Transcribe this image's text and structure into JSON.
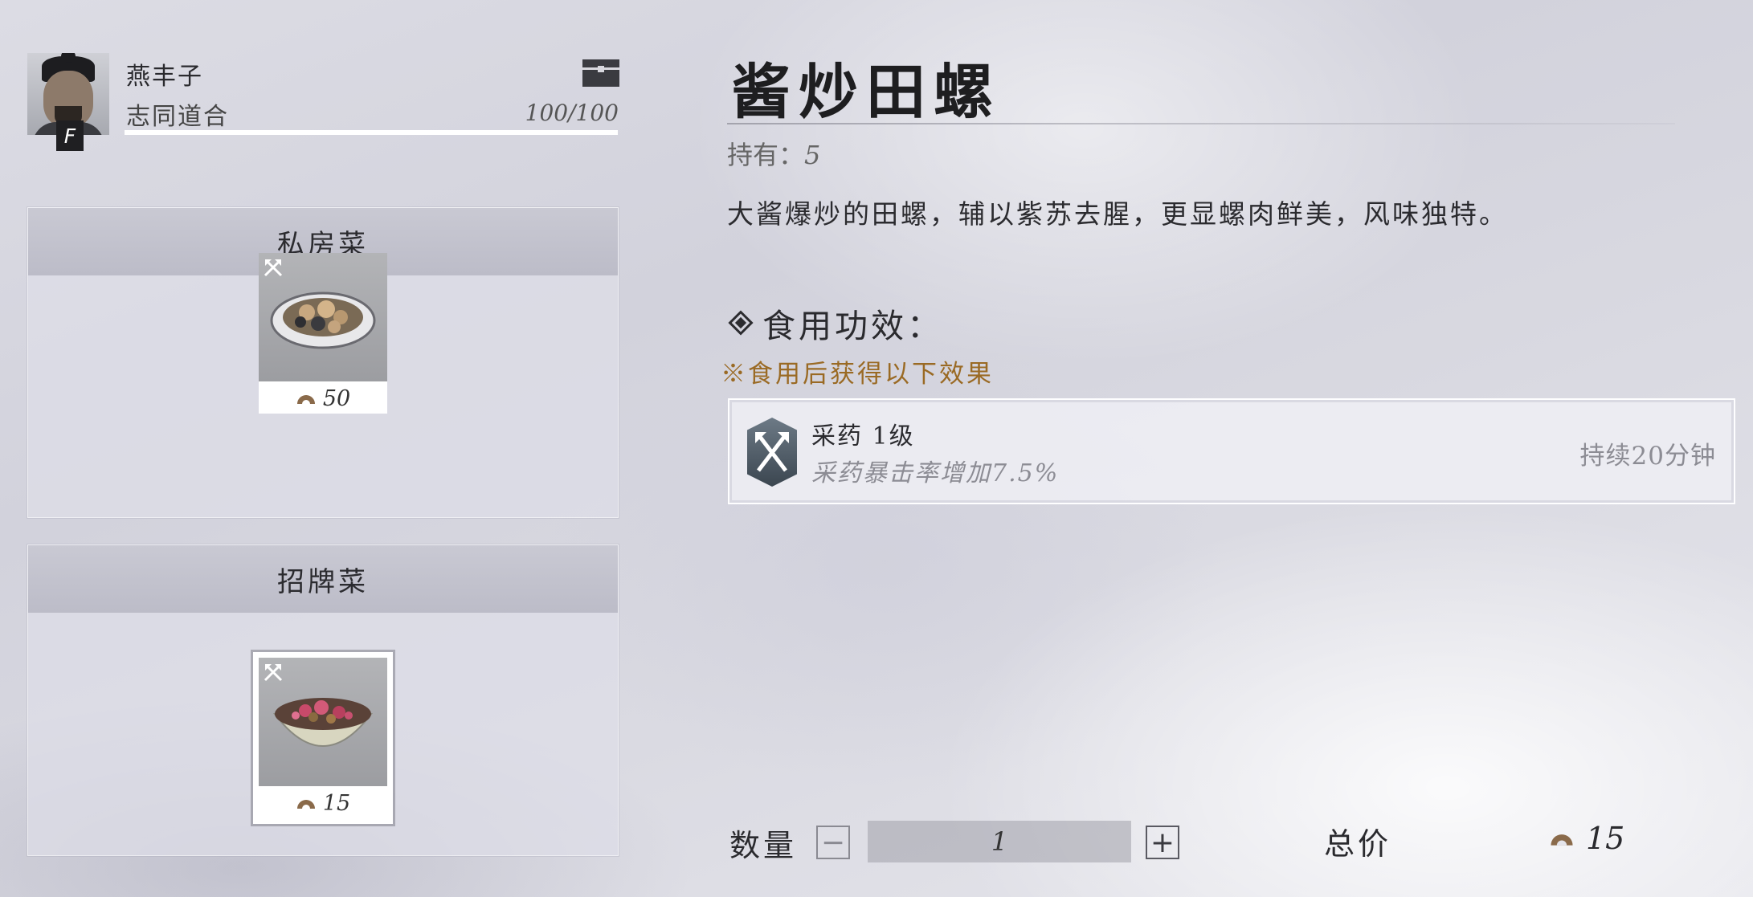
{
  "player": {
    "name": "燕丰子",
    "relation": "志同道合",
    "affinity": "100/100",
    "affinity_fraction": 1.0,
    "rank_badge": "F",
    "icons": {
      "chest": "chest-icon"
    }
  },
  "menus": [
    {
      "title": "私房菜",
      "dish": {
        "price": "50",
        "tool_icon": "crossed-axes-icon",
        "currency_icon": "coin-icon"
      }
    },
    {
      "title": "招牌菜",
      "dish": {
        "price": "15",
        "tool_icon": "crossed-axes-icon",
        "currency_icon": "coin-icon",
        "selected": true
      }
    }
  ],
  "detail": {
    "title": "酱炒田螺",
    "hold_label": "持有：",
    "hold_value": "5",
    "description": "大酱爆炒的田螺，辅以紫苏去腥，更显螺肉鲜美，风味独特。",
    "effect_heading": "食用功效：",
    "effect_note": "※食用后获得以下效果",
    "effect": {
      "name": "采药 1级",
      "desc": "采药暴击率增加7.5%",
      "duration": "持续20分钟",
      "icon": "herb-gathering-icon"
    }
  },
  "purchase": {
    "qty_label": "数量",
    "minus": "−",
    "plus": "+",
    "qty": "1",
    "total_label": "总价",
    "total": "15"
  },
  "colors": {
    "accent_note": "#9a6a24",
    "coin": "#8a6a4a"
  }
}
